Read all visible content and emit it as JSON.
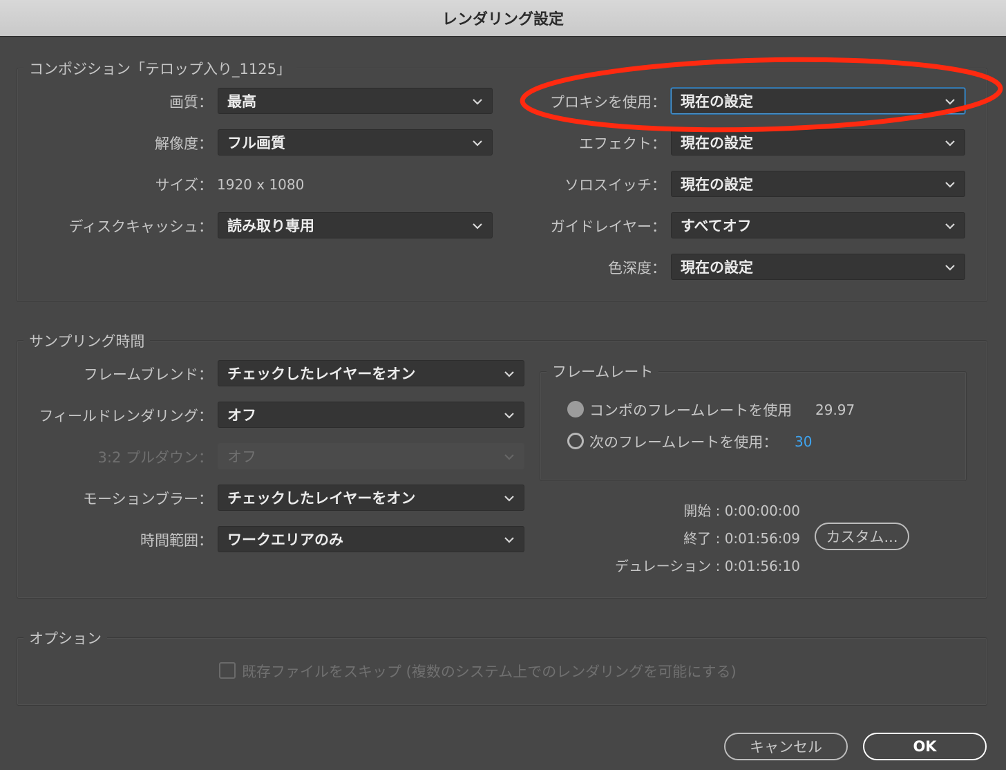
{
  "window": {
    "title": "レンダリング設定"
  },
  "composition": {
    "legend": "コンポジション「テロップ入り_1125」",
    "quality": {
      "label": "画質：",
      "value": "最高"
    },
    "resolution": {
      "label": "解像度：",
      "value": "フル画質"
    },
    "size": {
      "label": "サイズ：",
      "value": "1920 x 1080"
    },
    "disk_cache": {
      "label": "ディスクキャッシュ：",
      "value": "読み取り専用"
    },
    "proxy": {
      "label": "プロキシを使用：",
      "value": "現在の設定"
    },
    "effects": {
      "label": "エフェクト：",
      "value": "現在の設定"
    },
    "solo": {
      "label": "ソロスイッチ：",
      "value": "現在の設定"
    },
    "guide": {
      "label": "ガイドレイヤー：",
      "value": "すべてオフ"
    },
    "color_depth": {
      "label": "色深度：",
      "value": "現在の設定"
    }
  },
  "sampling": {
    "legend": "サンプリング時間",
    "frame_blend": {
      "label": "フレームブレンド：",
      "value": "チェックしたレイヤーをオン"
    },
    "field_render": {
      "label": "フィールドレンダリング：",
      "value": "オフ"
    },
    "pulldown": {
      "label": "3:2 プルダウン：",
      "value": "オフ"
    },
    "motion_blur": {
      "label": "モーションブラー：",
      "value": "チェックしたレイヤーをオン"
    },
    "time_span": {
      "label": "時間範囲：",
      "value": "ワークエリアのみ"
    },
    "frame_rate": {
      "legend": "フレームレート",
      "use_comp": {
        "label": "コンポのフレームレートを使用",
        "value": "29.97"
      },
      "use_this": {
        "label": "次のフレームレートを使用：",
        "value": "30"
      }
    },
    "start": "開始 : 0:00:00:00",
    "end": "終了 : 0:01:56:09",
    "duration": "デュレーション : 0:01:56:10",
    "custom_button": "カスタム..."
  },
  "options": {
    "legend": "オプション",
    "skip_existing": "既存ファイルをスキップ (複数のシステム上でのレンダリングを可能にする)"
  },
  "buttons": {
    "cancel": "キャンセル",
    "ok": "OK"
  },
  "colors": {
    "annotation": "#ff2a10",
    "focus": "#4aa2e6",
    "link_value": "#3ea4f0"
  }
}
